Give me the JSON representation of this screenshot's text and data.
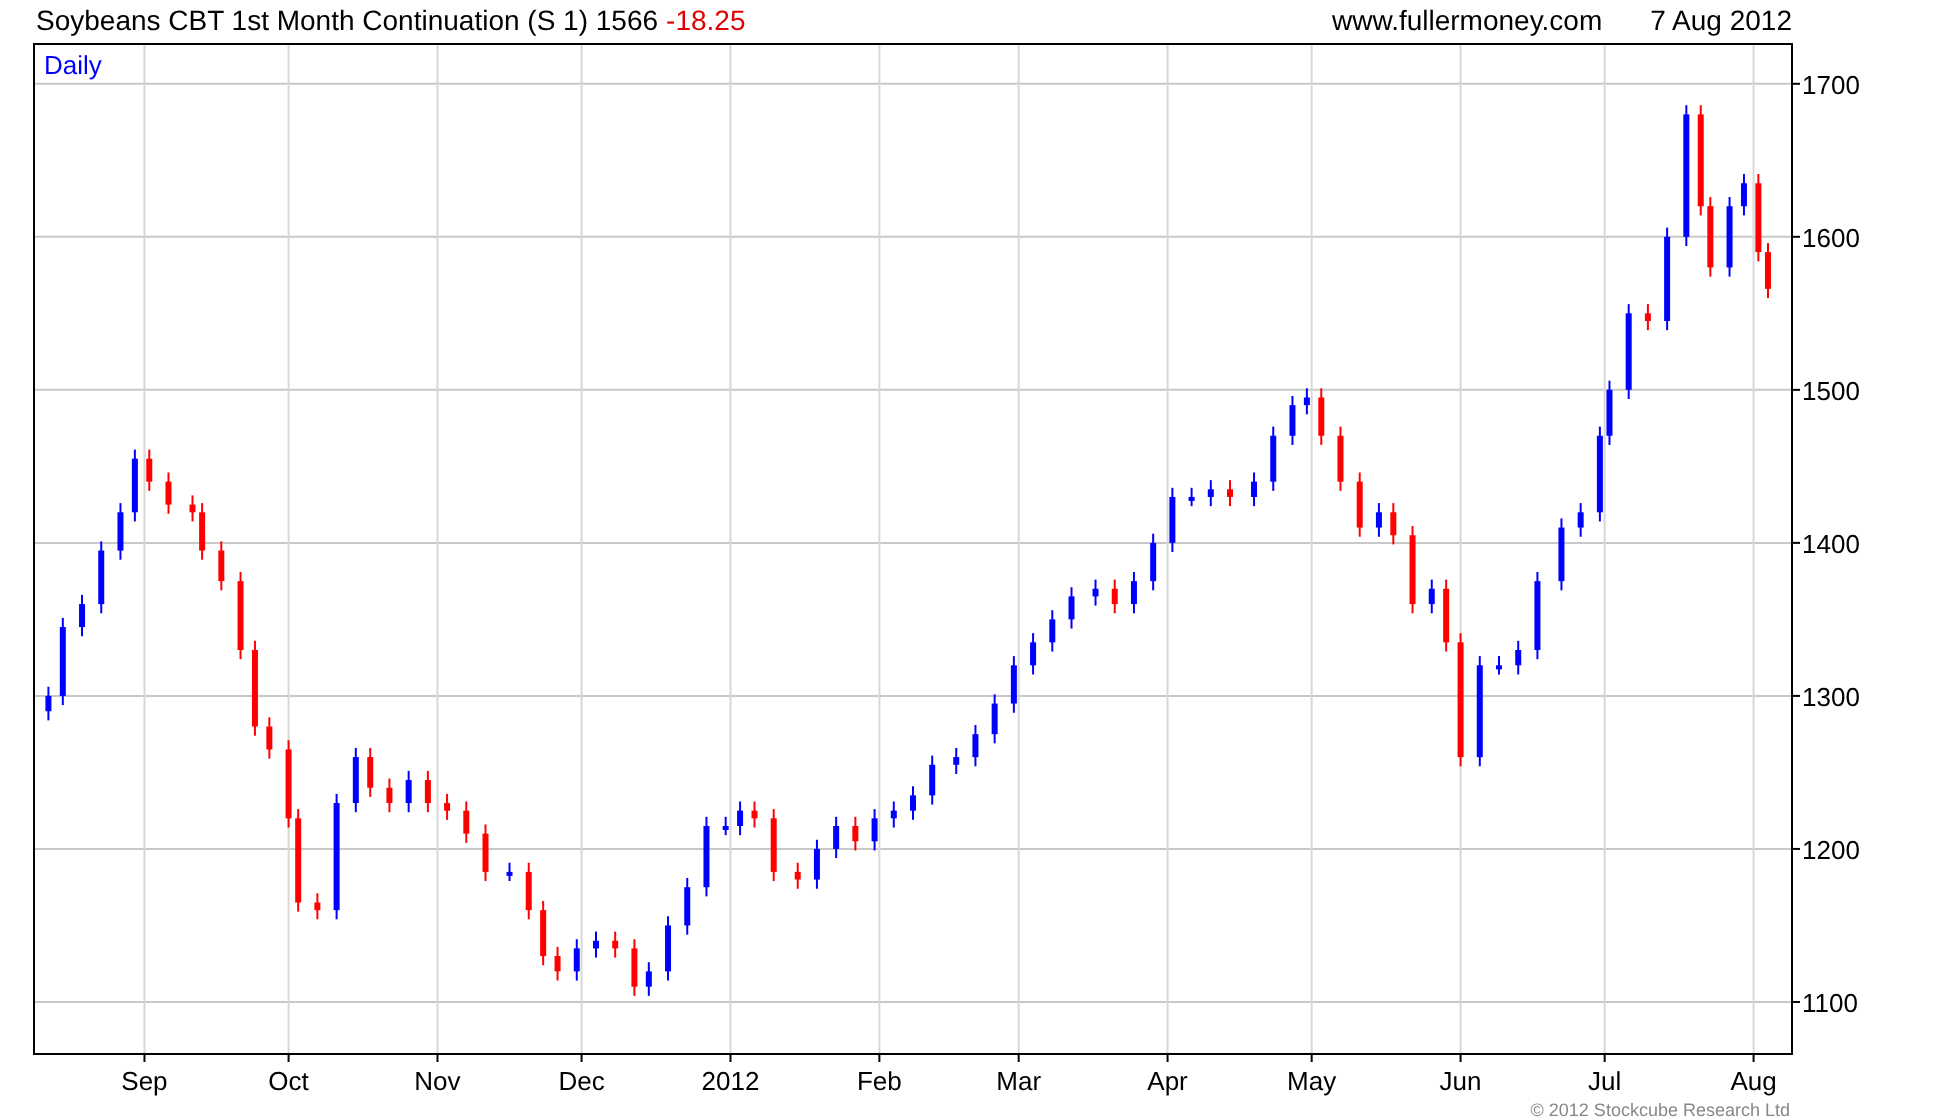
{
  "header": {
    "title": "Soybeans CBT 1st Month Continuation (S 1) 1566",
    "change": "-18.25",
    "source": "www.fullermoney.com",
    "date": "7 Aug 2012"
  },
  "chart": {
    "interval_label": "Daily",
    "chart_data": {
      "type": "candlestick",
      "grid": true,
      "xlim": [
        "2011-08-09",
        "2012-08-09"
      ],
      "ylim": [
        1066,
        1726
      ],
      "yticks": [
        1100,
        1200,
        1300,
        1400,
        1500,
        1600,
        1700
      ],
      "xticks": [
        {
          "value": "2011-09-01",
          "label": "Sep"
        },
        {
          "value": "2011-10-01",
          "label": "Oct"
        },
        {
          "value": "2011-11-01",
          "label": "Nov"
        },
        {
          "value": "2011-12-01",
          "label": "Dec"
        },
        {
          "value": "2012-01-01",
          "label": "2012"
        },
        {
          "value": "2012-02-01",
          "label": "Feb"
        },
        {
          "value": "2012-03-01",
          "label": "Mar"
        },
        {
          "value": "2012-04-01",
          "label": "Apr"
        },
        {
          "value": "2012-05-01",
          "label": "May"
        },
        {
          "value": "2012-06-01",
          "label": "Jun"
        },
        {
          "value": "2012-07-01",
          "label": "Jul"
        },
        {
          "value": "2012-08-01",
          "label": "Aug"
        }
      ],
      "x": [
        "2011-08-12",
        "2011-08-15",
        "2011-08-19",
        "2011-08-23",
        "2011-08-27",
        "2011-08-30",
        "2011-09-02",
        "2011-09-06",
        "2011-09-11",
        "2011-09-13",
        "2011-09-17",
        "2011-09-21",
        "2011-09-24",
        "2011-09-27",
        "2011-10-01",
        "2011-10-03",
        "2011-10-07",
        "2011-10-11",
        "2011-10-15",
        "2011-10-18",
        "2011-10-22",
        "2011-10-26",
        "2011-10-30",
        "2011-11-03",
        "2011-11-07",
        "2011-11-11",
        "2011-11-16",
        "2011-11-20",
        "2011-11-23",
        "2011-11-26",
        "2011-11-30",
        "2011-12-04",
        "2011-12-08",
        "2011-12-12",
        "2011-12-15",
        "2011-12-19",
        "2011-12-23",
        "2011-12-27",
        "2011-12-31",
        "2012-01-03",
        "2012-01-06",
        "2012-01-10",
        "2012-01-15",
        "2012-01-19",
        "2012-01-23",
        "2012-01-27",
        "2012-01-31",
        "2012-02-04",
        "2012-02-08",
        "2012-02-12",
        "2012-02-17",
        "2012-02-21",
        "2012-02-25",
        "2012-02-29",
        "2012-03-04",
        "2012-03-08",
        "2012-03-12",
        "2012-03-17",
        "2012-03-21",
        "2012-03-25",
        "2012-03-29",
        "2012-04-02",
        "2012-04-06",
        "2012-04-10",
        "2012-04-14",
        "2012-04-19",
        "2012-04-23",
        "2012-04-27",
        "2012-04-30",
        "2012-05-03",
        "2012-05-07",
        "2012-05-11",
        "2012-05-15",
        "2012-05-18",
        "2012-05-22",
        "2012-05-26",
        "2012-05-29",
        "2012-06-01",
        "2012-06-05",
        "2012-06-09",
        "2012-06-13",
        "2012-06-17",
        "2012-06-22",
        "2012-06-26",
        "2012-06-30",
        "2012-07-02",
        "2012-07-06",
        "2012-07-10",
        "2012-07-14",
        "2012-07-18",
        "2012-07-21",
        "2012-07-23",
        "2012-07-27",
        "2012-07-30",
        "2012-08-02",
        "2012-08-04"
      ],
      "ohlc": [
        [
          1290,
          1306,
          1284,
          1300
        ],
        [
          1300,
          1351,
          1294,
          1345
        ],
        [
          1345,
          1366,
          1339,
          1360
        ],
        [
          1360,
          1401,
          1354,
          1395
        ],
        [
          1395,
          1426,
          1389,
          1420
        ],
        [
          1420,
          1461,
          1414,
          1455
        ],
        [
          1455,
          1461,
          1434,
          1440
        ],
        [
          1440,
          1446,
          1419,
          1425
        ],
        [
          1425,
          1431,
          1414,
          1420
        ],
        [
          1420,
          1426,
          1389,
          1395
        ],
        [
          1395,
          1401,
          1369,
          1375
        ],
        [
          1375,
          1381,
          1324,
          1330
        ],
        [
          1330,
          1336,
          1274,
          1280
        ],
        [
          1280,
          1286,
          1259,
          1265
        ],
        [
          1265,
          1271,
          1214,
          1220
        ],
        [
          1220,
          1226,
          1159,
          1165
        ],
        [
          1165,
          1171,
          1154,
          1160
        ],
        [
          1160,
          1236,
          1154,
          1230
        ],
        [
          1230,
          1266,
          1224,
          1260
        ],
        [
          1260,
          1266,
          1234,
          1240
        ],
        [
          1240,
          1246,
          1224,
          1230
        ],
        [
          1230,
          1251,
          1224,
          1245
        ],
        [
          1245,
          1251,
          1224,
          1230
        ],
        [
          1230,
          1236,
          1219,
          1225
        ],
        [
          1225,
          1231,
          1204,
          1210
        ],
        [
          1210,
          1216,
          1179,
          1185
        ],
        [
          1185,
          1191,
          1179,
          1185
        ],
        [
          1185,
          1191,
          1154,
          1160
        ],
        [
          1160,
          1166,
          1124,
          1130
        ],
        [
          1130,
          1136,
          1114,
          1120
        ],
        [
          1120,
          1141,
          1114,
          1135
        ],
        [
          1135,
          1146,
          1129,
          1140
        ],
        [
          1140,
          1146,
          1129,
          1135
        ],
        [
          1135,
          1141,
          1104,
          1110
        ],
        [
          1110,
          1126,
          1104,
          1120
        ],
        [
          1120,
          1156,
          1114,
          1150
        ],
        [
          1150,
          1181,
          1144,
          1175
        ],
        [
          1175,
          1221,
          1169,
          1215
        ],
        [
          1215,
          1221,
          1209,
          1215
        ],
        [
          1215,
          1231,
          1209,
          1225
        ],
        [
          1225,
          1231,
          1214,
          1220
        ],
        [
          1220,
          1226,
          1179,
          1185
        ],
        [
          1185,
          1191,
          1174,
          1180
        ],
        [
          1180,
          1206,
          1174,
          1200
        ],
        [
          1200,
          1221,
          1194,
          1215
        ],
        [
          1215,
          1221,
          1199,
          1205
        ],
        [
          1205,
          1226,
          1199,
          1220
        ],
        [
          1220,
          1231,
          1214,
          1225
        ],
        [
          1225,
          1241,
          1219,
          1235
        ],
        [
          1235,
          1261,
          1229,
          1255
        ],
        [
          1255,
          1266,
          1249,
          1260
        ],
        [
          1260,
          1281,
          1254,
          1275
        ],
        [
          1275,
          1301,
          1269,
          1295
        ],
        [
          1295,
          1326,
          1289,
          1320
        ],
        [
          1320,
          1341,
          1314,
          1335
        ],
        [
          1335,
          1356,
          1329,
          1350
        ],
        [
          1350,
          1371,
          1344,
          1365
        ],
        [
          1365,
          1376,
          1359,
          1370
        ],
        [
          1370,
          1376,
          1354,
          1360
        ],
        [
          1360,
          1381,
          1354,
          1375
        ],
        [
          1375,
          1406,
          1369,
          1400
        ],
        [
          1400,
          1436,
          1394,
          1430
        ],
        [
          1430,
          1436,
          1424,
          1430
        ],
        [
          1430,
          1441,
          1424,
          1435
        ],
        [
          1435,
          1441,
          1424,
          1430
        ],
        [
          1430,
          1446,
          1424,
          1440
        ],
        [
          1440,
          1476,
          1434,
          1470
        ],
        [
          1470,
          1496,
          1464,
          1490
        ],
        [
          1490,
          1501,
          1484,
          1495
        ],
        [
          1495,
          1501,
          1464,
          1470
        ],
        [
          1470,
          1476,
          1434,
          1440
        ],
        [
          1440,
          1446,
          1404,
          1410
        ],
        [
          1410,
          1426,
          1404,
          1420
        ],
        [
          1420,
          1426,
          1399,
          1405
        ],
        [
          1405,
          1411,
          1354,
          1360
        ],
        [
          1360,
          1376,
          1354,
          1370
        ],
        [
          1370,
          1376,
          1329,
          1335
        ],
        [
          1335,
          1341,
          1254,
          1260
        ],
        [
          1260,
          1326,
          1254,
          1320
        ],
        [
          1320,
          1326,
          1314,
          1320
        ],
        [
          1320,
          1336,
          1314,
          1330
        ],
        [
          1330,
          1381,
          1324,
          1375
        ],
        [
          1375,
          1416,
          1369,
          1410
        ],
        [
          1410,
          1426,
          1404,
          1420
        ],
        [
          1420,
          1476,
          1414,
          1470
        ],
        [
          1470,
          1506,
          1464,
          1500
        ],
        [
          1500,
          1556,
          1494,
          1550
        ],
        [
          1550,
          1556,
          1539,
          1545
        ],
        [
          1545,
          1606,
          1539,
          1600
        ],
        [
          1600,
          1686,
          1594,
          1680
        ],
        [
          1680,
          1686,
          1614,
          1620
        ],
        [
          1620,
          1626,
          1574,
          1580
        ],
        [
          1580,
          1626,
          1574,
          1620
        ],
        [
          1620,
          1641,
          1614,
          1635
        ],
        [
          1635,
          1641,
          1584,
          1590
        ],
        [
          1590,
          1596,
          1560,
          1566
        ]
      ]
    }
  },
  "footer": {
    "copyright": "© 2012 Stockcube Research Ltd"
  }
}
